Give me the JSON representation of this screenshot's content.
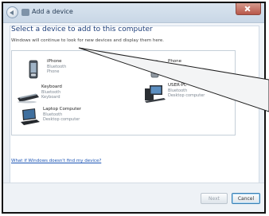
{
  "window": {
    "title": "Add a device"
  },
  "content": {
    "heading": "Select a device to add to this computer",
    "subtext": "Windows will continue to look for new devices and display them here."
  },
  "devices": [
    {
      "name": "iPhone",
      "type": "Bluetooth",
      "category": "Phone",
      "icon": "phone-icon"
    },
    {
      "name": "Phone",
      "type": "Bluetooth",
      "category": "Phone",
      "icon": "phone-icon"
    },
    {
      "name": "Keyboard",
      "type": "Bluetooth",
      "category": "Keyboard",
      "icon": "keyboard-icon"
    },
    {
      "name": "USER-PC",
      "type": "Bluetooth",
      "category": "Desktop computer",
      "icon": "desktop-icon"
    },
    {
      "name": "Laptop Computer",
      "type": "Bluetooth",
      "category": "Desktop computer",
      "icon": "laptop-icon"
    }
  ],
  "links": {
    "no_device": "What if Windows doesn't find my device?"
  },
  "buttons": {
    "next": "Next",
    "cancel": "Cancel"
  },
  "colors": {
    "accent": "#1e3f7a",
    "link": "#1c55b5"
  }
}
